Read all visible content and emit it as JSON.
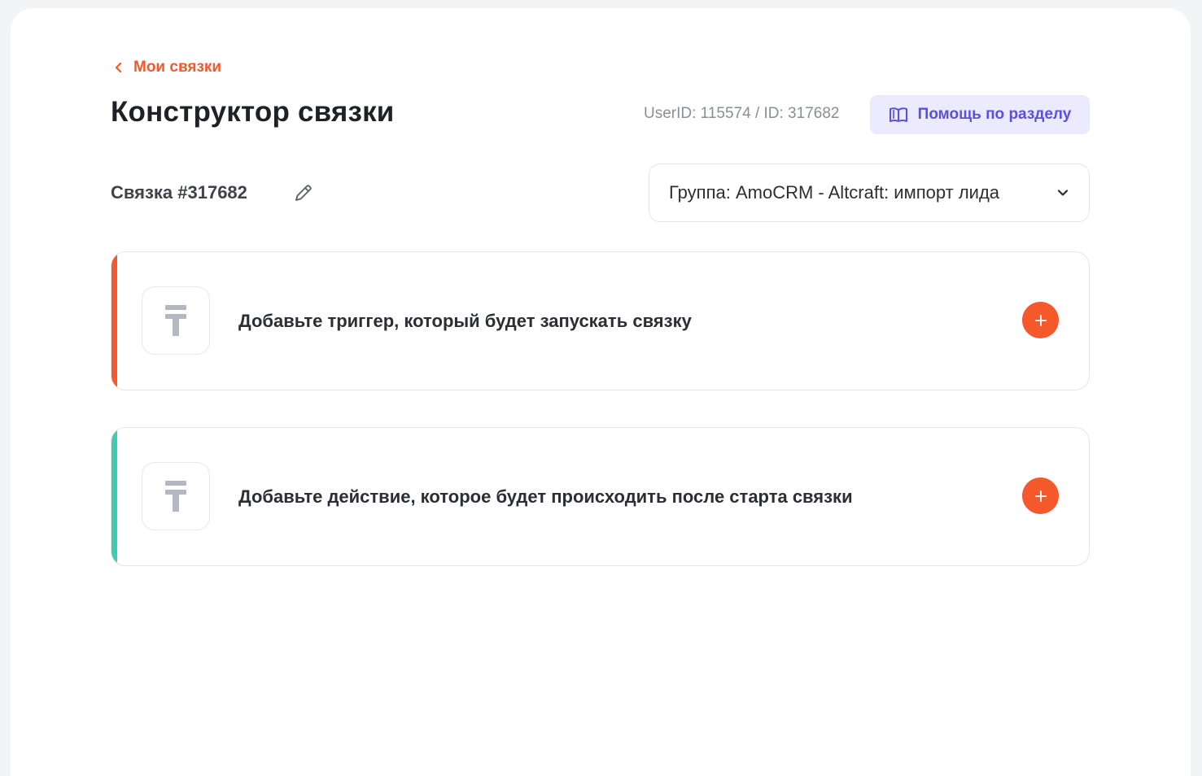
{
  "breadcrumb": {
    "back_label": "Мои связки"
  },
  "header": {
    "title": "Конструктор связки",
    "ids": "UserID: 115574 / ID: 317682",
    "help_label": "Помощь по разделу"
  },
  "connection": {
    "name": "Связка #317682",
    "group_value": "Группа: AmoCRM - Altcraft: импорт лида"
  },
  "steps": [
    {
      "label": "Добавьте триггер, который будет запускать связку",
      "accent_color": "#f4582b"
    },
    {
      "label": "Добавьте действие, которое будет происходить после старта связки",
      "accent_color": "#3ecdb3"
    }
  ],
  "colors": {
    "brand": "#f4582b",
    "help_bg": "#eceaff",
    "help_text": "#5a4fe0",
    "placeholder_icon": "#b3b8c2"
  },
  "icons": {
    "back": "chevron-left-icon",
    "help": "book-icon",
    "edit": "pencil-icon",
    "dropdown": "chevron-down-icon",
    "step": "t-logo-icon",
    "add": "plus-icon"
  }
}
